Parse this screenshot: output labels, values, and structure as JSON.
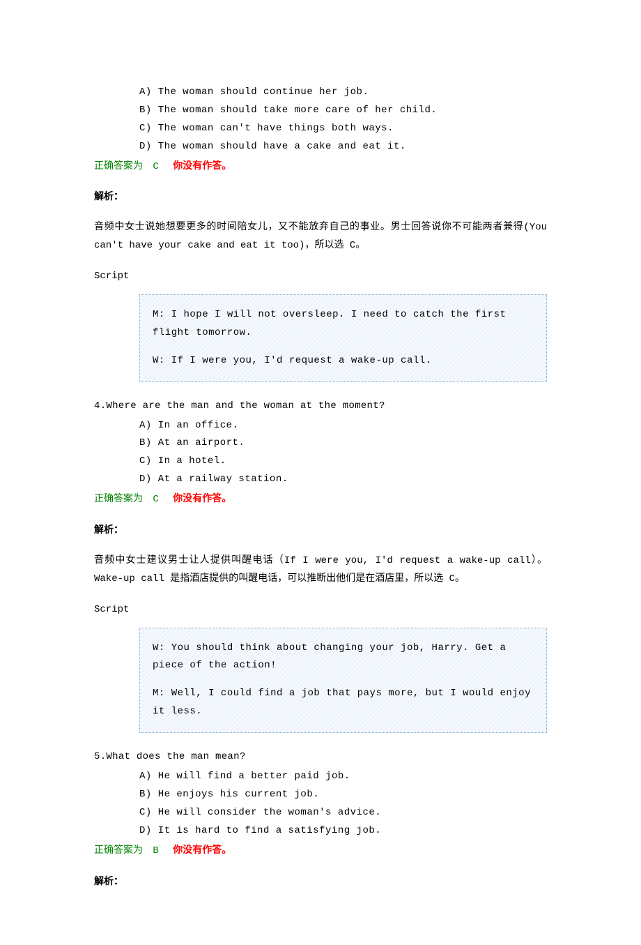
{
  "q3": {
    "options": {
      "a": "A) The woman should continue her job.",
      "b": "B) The woman should take more care of her child.",
      "c": "C) The woman can't have things both ways.",
      "d": "D) The woman should have a cake and eat it."
    },
    "answer_prefix": "正确答案为",
    "answer_letter": "C",
    "no_answer": "你没有作答。",
    "analysis_title": "解析：",
    "analysis_text": "音频中女士说她想要更多的时间陪女儿，又不能放弃自己的事业。男士回答说你不可能两者兼得(You can't have your cake and eat it too)，所以选 C。",
    "script_title": "Script",
    "script": {
      "line1": "M: I hope I will not oversleep. I need to catch the first flight tomorrow.",
      "line2": "W: If I were you, I'd request a wake-up call."
    }
  },
  "q4": {
    "question": "4.Where are the man and the woman at the moment?",
    "options": {
      "a": "A) In an office.",
      "b": "B) At an airport.",
      "c": "C) In a hotel.",
      "d": "D) At a railway station."
    },
    "answer_prefix": "正确答案为",
    "answer_letter": "C",
    "no_answer": "你没有作答。",
    "analysis_title": "解析：",
    "analysis_text": "音频中女士建议男士让人提供叫醒电话（If I were you, I'd request a wake-up call）。Wake-up call 是指酒店提供的叫醒电话，可以推断出他们是在酒店里，所以选 C。",
    "script_title": "Script",
    "script": {
      "line1": "W: You should think about changing your job, Harry. Get a piece of the action!",
      "line2": "M: Well, I could find a job that pays more, but I would enjoy it less."
    }
  },
  "q5": {
    "question": "5.What does the man mean?",
    "options": {
      "a": "A) He will find a better paid job.",
      "b": "B) He enjoys his current job.",
      "c": "C) He will consider the woman's advice.",
      "d": "D) It is hard to find a satisfying job."
    },
    "answer_prefix": "正确答案为",
    "answer_letter": "B",
    "no_answer": "你没有作答。",
    "analysis_title": "解析："
  }
}
